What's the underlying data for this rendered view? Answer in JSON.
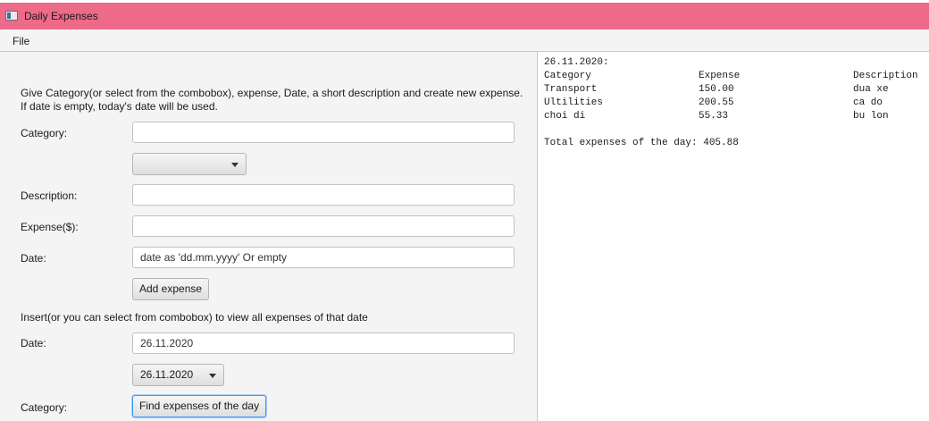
{
  "window": {
    "title": "Daily Expenses"
  },
  "menu": {
    "file": "File"
  },
  "form": {
    "instructions_line1": "Give Category(or select from the combobox), expense, Date, a short description and create new expense.",
    "instructions_line2": "If date is empty, today's date will be used.",
    "category_label": "Category:",
    "category_value": "",
    "category_combo_value": "",
    "description_label": "Description:",
    "description_value": "",
    "expense_label": "Expense($):",
    "expense_value": "",
    "date_label": "Date:",
    "date_placeholder": "date as 'dd.mm.yyyy' Or empty",
    "add_button": "Add expense"
  },
  "view": {
    "instructions": "Insert(or you can select from combobox) to view all expenses of that date",
    "date_label": "Date:",
    "date_value": "26.11.2020",
    "date_combo_value": "26.11.2020",
    "category_label": "Category:",
    "find_button": "Find expenses of the day"
  },
  "output": {
    "date_header": "26.11.2020:",
    "columns": [
      "Category",
      "Expense",
      "Description"
    ],
    "rows": [
      [
        "Transport",
        "150.00",
        "dua xe"
      ],
      [
        "Ultilities",
        "200.55",
        "ca do"
      ],
      [
        "choi di",
        "55.33",
        "bu lon"
      ]
    ],
    "total": "Total expenses of the day: 405.88"
  }
}
